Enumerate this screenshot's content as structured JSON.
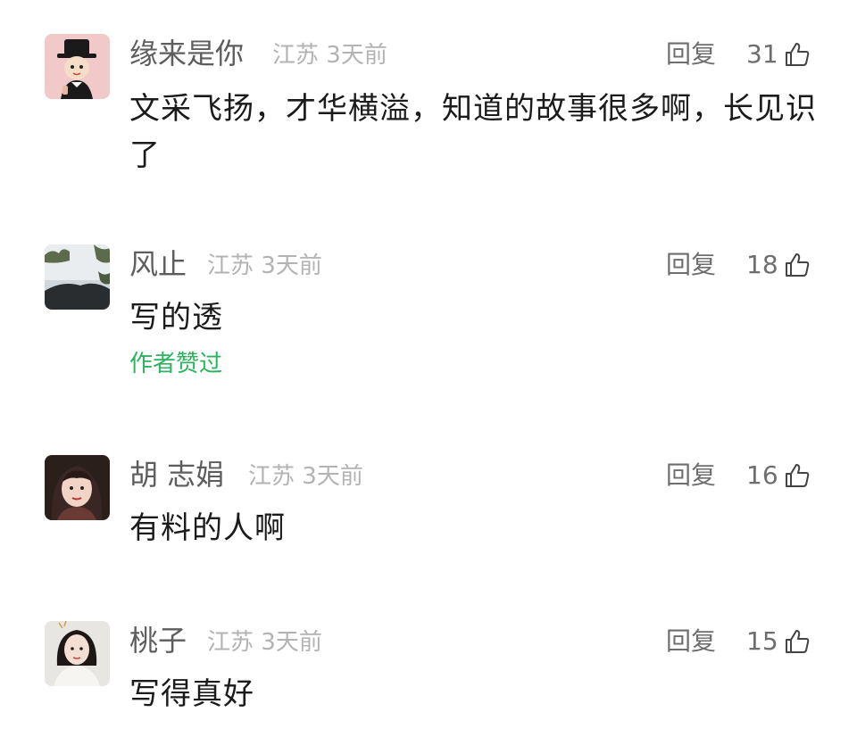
{
  "comments": [
    {
      "username": "缘来是你",
      "location": "江苏",
      "time": "3天前",
      "reply_label": "回复",
      "likes": "31",
      "content": "文采飞扬，才华横溢，知道的故事很多啊，长见识了",
      "author_liked": ""
    },
    {
      "username": "风止",
      "location": "江苏",
      "time": "3天前",
      "reply_label": "回复",
      "likes": "18",
      "content": "写的透",
      "author_liked": "作者赞过"
    },
    {
      "username": "胡 志娟",
      "location": "江苏",
      "time": "3天前",
      "reply_label": "回复",
      "likes": "16",
      "content": "有料的人啊",
      "author_liked": ""
    },
    {
      "username": "桃子",
      "location": "江苏",
      "time": "3天前",
      "reply_label": "回复",
      "likes": "15",
      "content": "写得真好",
      "author_liked": ""
    }
  ],
  "icons": {
    "like": "thumbs-up-icon"
  },
  "colors": {
    "author_liked": "#2bb35e",
    "username": "#5d5d5d",
    "meta": "#b3b3b3"
  }
}
